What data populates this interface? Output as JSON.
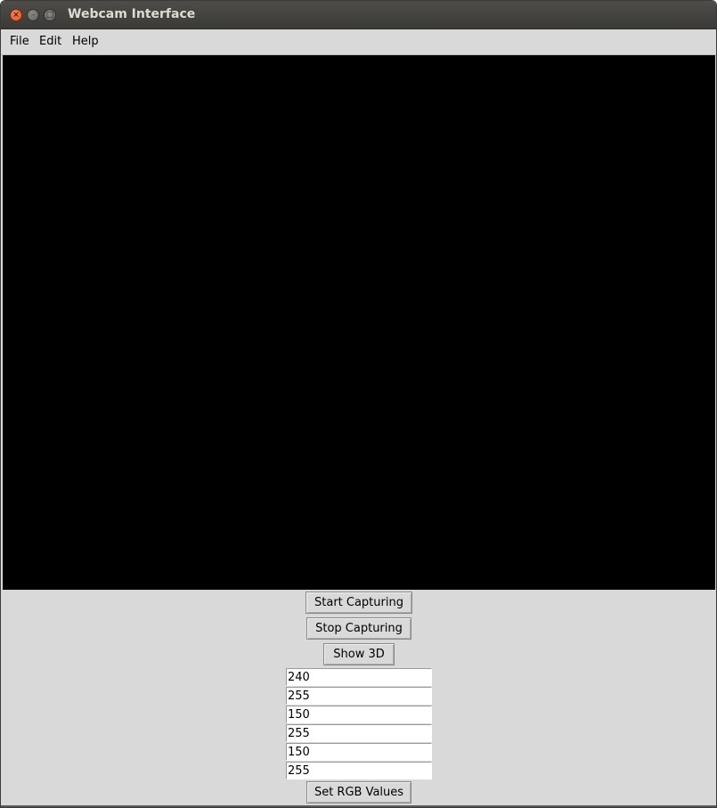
{
  "window": {
    "title": "Webcam Interface"
  },
  "menu": {
    "items": [
      "File",
      "Edit",
      "Help"
    ]
  },
  "controls": {
    "start_label": "Start Capturing",
    "stop_label": "Stop Capturing",
    "show3d_label": "Show 3D",
    "set_rgb_label": "Set RGB Values"
  },
  "rgb_entries": [
    "240",
    "255",
    "150",
    "255",
    "150",
    "255"
  ],
  "colors": {
    "title_bar": "#3c3b37",
    "close_button": "#e95420",
    "window_background": "#d9d9d9",
    "video_background": "#000000"
  },
  "icons": {
    "close": "close-icon",
    "minimize": "minimize-icon",
    "maximize": "maximize-icon"
  }
}
